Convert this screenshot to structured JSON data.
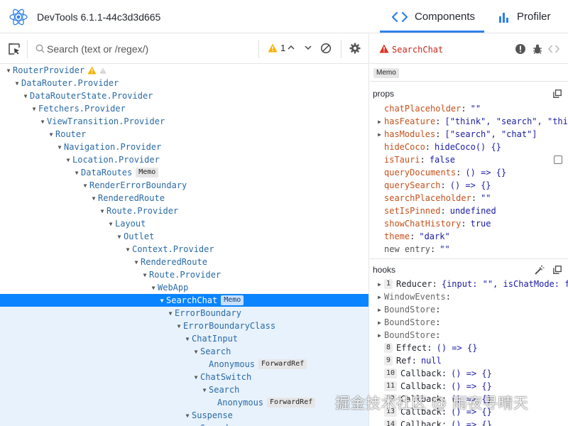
{
  "app": {
    "title": "DevTools 6.1.1-44c3d3d665"
  },
  "tabs": [
    {
      "label": "Components",
      "icon": "components-icon",
      "active": true
    },
    {
      "label": "Profiler",
      "icon": "profiler-icon",
      "active": false
    }
  ],
  "toolbar": {
    "search_placeholder": "Search (text or /regex/)",
    "warning_count": "1"
  },
  "tree": [
    {
      "label": "RouterProvider",
      "depth": 0,
      "expanded": true,
      "warning": true
    },
    {
      "label": "DataRouter.Provider",
      "depth": 1,
      "expanded": true
    },
    {
      "label": "DataRouterState.Provider",
      "depth": 2,
      "expanded": true
    },
    {
      "label": "Fetchers.Provider",
      "depth": 3,
      "expanded": true
    },
    {
      "label": "ViewTransition.Provider",
      "depth": 4,
      "expanded": true
    },
    {
      "label": "Router",
      "depth": 5,
      "expanded": true
    },
    {
      "label": "Navigation.Provider",
      "depth": 6,
      "expanded": true
    },
    {
      "label": "Location.Provider",
      "depth": 7,
      "expanded": true
    },
    {
      "label": "DataRoutes",
      "depth": 8,
      "expanded": true,
      "badge": "Memo"
    },
    {
      "label": "RenderErrorBoundary",
      "depth": 9,
      "expanded": true
    },
    {
      "label": "RenderedRoute",
      "depth": 10,
      "expanded": true
    },
    {
      "label": "Route.Provider",
      "depth": 11,
      "expanded": true
    },
    {
      "label": "Layout",
      "depth": 12,
      "expanded": true
    },
    {
      "label": "Outlet",
      "depth": 13,
      "expanded": true
    },
    {
      "label": "Context.Provider",
      "depth": 14,
      "expanded": true
    },
    {
      "label": "RenderedRoute",
      "depth": 15,
      "expanded": true
    },
    {
      "label": "Route.Provider",
      "depth": 16,
      "expanded": true
    },
    {
      "label": "WebApp",
      "depth": 17,
      "expanded": true
    },
    {
      "label": "SearchChat",
      "depth": 18,
      "expanded": true,
      "badge": "Memo",
      "selected": true
    },
    {
      "label": "ErrorBoundary",
      "depth": 19,
      "expanded": true,
      "sub": true
    },
    {
      "label": "ErrorBoundaryClass",
      "depth": 20,
      "expanded": true,
      "sub": true
    },
    {
      "label": "ChatInput",
      "depth": 21,
      "expanded": true,
      "sub": true
    },
    {
      "label": "Search",
      "depth": 22,
      "expanded": true,
      "sub": true
    },
    {
      "label": "Anonymous",
      "depth": 23,
      "leaf": true,
      "badge": "ForwardRef",
      "sub": true
    },
    {
      "label": "ChatSwitch",
      "depth": 22,
      "expanded": true,
      "sub": true
    },
    {
      "label": "Search",
      "depth": 23,
      "expanded": true,
      "sub": true
    },
    {
      "label": "Anonymous",
      "depth": 24,
      "leaf": true,
      "badge": "ForwardRef",
      "sub": true
    },
    {
      "label": "Suspense",
      "depth": 21,
      "expanded": true,
      "sub": true
    },
    {
      "label": "Search",
      "depth": 22,
      "leaf": true,
      "sub": true
    }
  ],
  "inspector": {
    "selected_name": "SearchChat",
    "badge": "Memo",
    "props_title": "props",
    "props": [
      {
        "key": "chatPlaceholder",
        "value": "\"\"",
        "expandable": false
      },
      {
        "key": "hasFeature",
        "value": "[\"think\", \"search\", \"thin…",
        "expandable": true
      },
      {
        "key": "hasModules",
        "value": "[\"search\", \"chat\"]",
        "expandable": true
      },
      {
        "key": "hideCoco",
        "value": "hideCoco() {}",
        "expandable": false
      },
      {
        "key": "isTauri",
        "value": "false",
        "expandable": false
      },
      {
        "key": "queryDocuments",
        "value": "() => {}",
        "expandable": false
      },
      {
        "key": "querySearch",
        "value": "() => {}",
        "expandable": false
      },
      {
        "key": "searchPlaceholder",
        "value": "\"\"",
        "expandable": false
      },
      {
        "key": "setIsPinned",
        "value": "undefined",
        "expandable": false
      },
      {
        "key": "showChatHistory",
        "value": "true",
        "expandable": false
      },
      {
        "key": "theme",
        "value": "\"dark\"",
        "expandable": false
      },
      {
        "key": "new entry",
        "value": "\"\"",
        "expandable": false,
        "plain": true
      }
    ],
    "hooks_title": "hooks",
    "hooks": [
      {
        "index": "1",
        "name": "Reducer",
        "value": "{input: \"\", isChatMode: f…",
        "expandable": true
      },
      {
        "index": "",
        "name": "WindowEvents",
        "value": "",
        "expandable": true,
        "dim": true
      },
      {
        "index": "",
        "name": "BoundStore",
        "value": "",
        "expandable": true,
        "dim": true
      },
      {
        "index": "",
        "name": "BoundStore",
        "value": "",
        "expandable": true,
        "dim": true
      },
      {
        "index": "",
        "name": "BoundStore",
        "value": "",
        "expandable": true,
        "dim": true
      },
      {
        "index": "8",
        "name": "Effect",
        "value": "() => {}",
        "expandable": false
      },
      {
        "index": "9",
        "name": "Ref",
        "value": "null",
        "expandable": false
      },
      {
        "index": "10",
        "name": "Callback",
        "value": "() => {}",
        "expandable": false
      },
      {
        "index": "11",
        "name": "Callback",
        "value": "() => {}",
        "expandable": false
      },
      {
        "index": "12",
        "name": "Callback",
        "value": "() => {}",
        "expandable": false
      },
      {
        "index": "13",
        "name": "Callback",
        "value": "() => {}",
        "expandable": false
      },
      {
        "index": "14",
        "name": "Callback",
        "value": "() => {}",
        "expandable": false
      }
    ]
  },
  "watermark": "掘金技术社区 @ 雨夜寻晴天",
  "colors": {
    "accent": "#2f80ed",
    "selected_row": "#0a84ff",
    "component_name": "#2a6aa6",
    "prop_key": "#c4511c",
    "warning": "#f5b400",
    "error": "#d93025"
  }
}
